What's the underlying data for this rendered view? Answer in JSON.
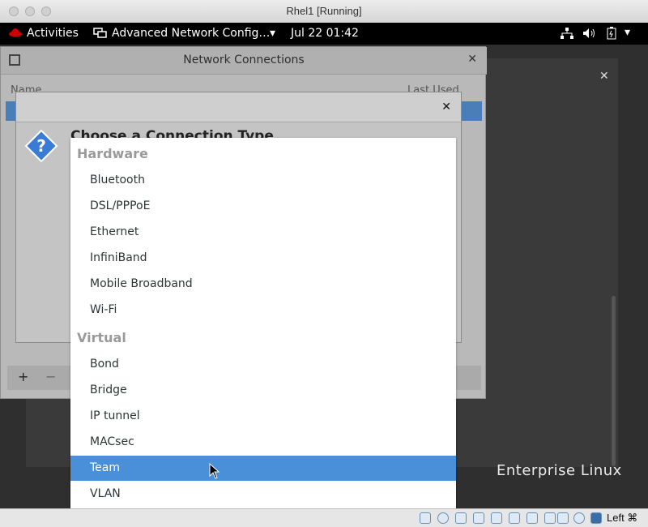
{
  "host": {
    "title": "Rhel1 [Running]"
  },
  "topbar": {
    "activities": "Activities",
    "app_menu": "Advanced Network Config…",
    "clock": "Jul 22  01:42"
  },
  "network_window": {
    "title": "Network Connections",
    "col_name": "Name",
    "col_last_used": "Last Used",
    "add_label": "+",
    "remove_label": "−"
  },
  "dialog": {
    "title": "Choose a Connection Type"
  },
  "menu": {
    "hardware_header": "Hardware",
    "hardware_items": [
      "Bluetooth",
      "DSL/PPPoE",
      "Ethernet",
      "InfiniBand",
      "Mobile Broadband",
      "Wi-Fi"
    ],
    "virtual_header": "Virtual",
    "virtual_items": [
      "Bond",
      "Bridge",
      "IP tunnel",
      "MACsec",
      "Team",
      "VLAN"
    ],
    "selected": "Team"
  },
  "desktop": {
    "brand_text": "Enterprise Linux"
  },
  "statusbar": {
    "host_key": "Left ⌘"
  },
  "colors": {
    "selection": "#4a90d9",
    "topbar": "#000000",
    "brand_logo": "#cc0000"
  }
}
